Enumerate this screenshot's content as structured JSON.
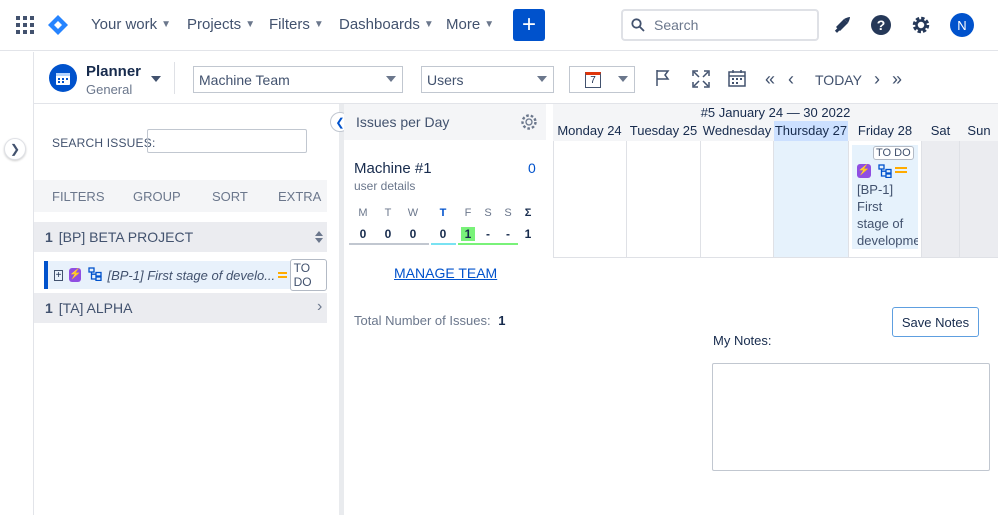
{
  "nav": {
    "items": [
      "Your work",
      "Projects",
      "Filters",
      "Dashboards",
      "More"
    ],
    "search_placeholder": "Search",
    "avatar_initial": "N"
  },
  "toolbar": {
    "app_title": "Planner",
    "app_subtitle": "General",
    "team_select": "Machine Team",
    "users_select": "Users",
    "calendar_day": "7",
    "today_label": "TODAY"
  },
  "left": {
    "search_label": "SEARCH ISSUES:",
    "tabs": [
      "FILTERS",
      "GROUP",
      "SORT",
      "EXTRA"
    ],
    "projects": [
      {
        "count": "1",
        "name": "[BP] BETA PROJECT"
      },
      {
        "count": "1",
        "name": "[TA] ALPHA"
      }
    ],
    "issue": {
      "text": "[BP-1] First stage of develo...",
      "status": "TO DO"
    }
  },
  "main": {
    "issues_per_day": "Issues per Day",
    "week_title": "#5 January 24 — 30 2022",
    "days": [
      "Monday 24",
      "Tuesday 25",
      "Wednesday",
      "Thursday 27",
      "Friday 28",
      "Sat",
      "Sun"
    ],
    "machine": {
      "name": "Machine #1",
      "details": "user details",
      "count": "0",
      "stat_labels": [
        "M",
        "T",
        "W",
        "T",
        "F",
        "S",
        "S",
        "Σ"
      ],
      "stat_values": [
        "0",
        "0",
        "0",
        "0",
        "1",
        "-",
        "-",
        "1"
      ]
    },
    "card": {
      "status": "TO DO",
      "line1": "[BP-1]",
      "line2": "First",
      "line3": "stage of",
      "line4": "developme"
    },
    "manage_team": "MANAGE TEAM",
    "total_label": "Total Number of Issues:",
    "total_value": "1",
    "save_notes": "Save Notes",
    "my_notes": "My Notes:"
  },
  "colors": {
    "accent": "#0052cc",
    "today_bg": "#e6f2fc",
    "weekend_bg": "#f4f5f7"
  }
}
